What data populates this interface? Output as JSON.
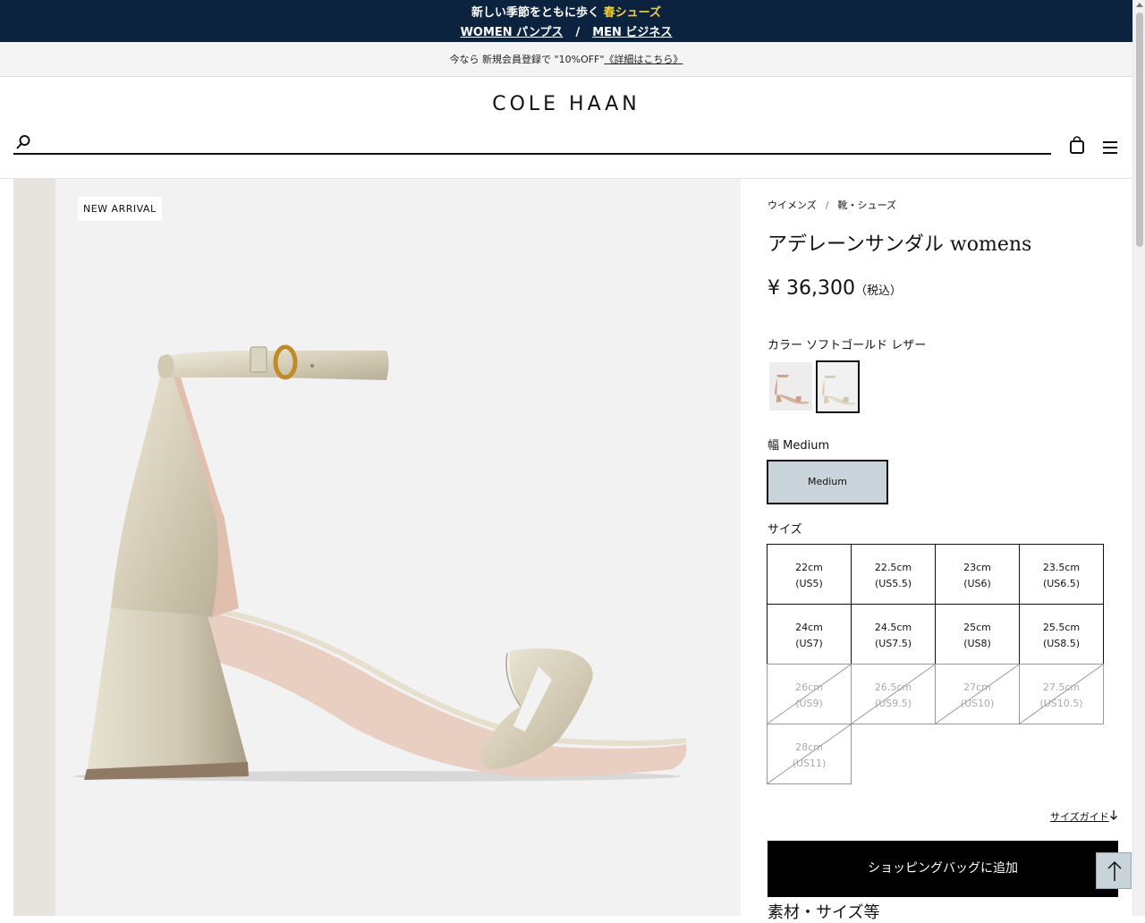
{
  "promo": {
    "headline_prefix": "新しい季節をともに歩く",
    "headline_highlight": "春シューズ",
    "women_link": "WOMEN パンプス",
    "separator": "/",
    "men_link": "MEN ビジネス"
  },
  "notice": {
    "text": "今なら 新規会員登録で \"10%OFF\"",
    "link": "《詳細はこちら》"
  },
  "header": {
    "logo": "COLE HAAN",
    "search_placeholder": ""
  },
  "product": {
    "badge": "NEW ARRIVAL",
    "breadcrumb": [
      "ウイメンズ",
      "靴・シューズ"
    ],
    "breadcrumb_sep": "/",
    "title": "アデレーンサンダル womens",
    "price": "¥ 36,300",
    "price_tax": "（税込）",
    "color_label": "カラー ソフトゴールド レザー",
    "width_label": "幅 Medium",
    "width_option": "Medium",
    "size_label": "サイズ",
    "sizes": [
      {
        "cm": "22cm",
        "us": "(US5)",
        "available": true
      },
      {
        "cm": "22.5cm",
        "us": "(US5.5)",
        "available": true
      },
      {
        "cm": "23cm",
        "us": "(US6)",
        "available": true
      },
      {
        "cm": "23.5cm",
        "us": "(US6.5)",
        "available": true
      },
      {
        "cm": "24cm",
        "us": "(US7)",
        "available": true
      },
      {
        "cm": "24.5cm",
        "us": "(US7.5)",
        "available": true
      },
      {
        "cm": "25cm",
        "us": "(US8)",
        "available": true
      },
      {
        "cm": "25.5cm",
        "us": "(US8.5)",
        "available": true
      },
      {
        "cm": "26cm",
        "us": "(US9)",
        "available": false
      },
      {
        "cm": "26.5cm",
        "us": "(US9.5)",
        "available": false
      },
      {
        "cm": "27cm",
        "us": "(US10)",
        "available": false
      },
      {
        "cm": "27.5cm",
        "us": "(US10.5)",
        "available": false
      },
      {
        "cm": "28cm",
        "us": "(US11)",
        "available": false
      }
    ],
    "size_guide": "サイズガイド",
    "add_to_bag": "ショッピングバッグに追加",
    "materials_heading": "素材・サイズ等"
  },
  "colors": {
    "promo_bg": "#0c2340",
    "promo_highlight": "#f3d03e",
    "width_selected_bg": "#c9d3da",
    "button_bg": "#000000"
  }
}
